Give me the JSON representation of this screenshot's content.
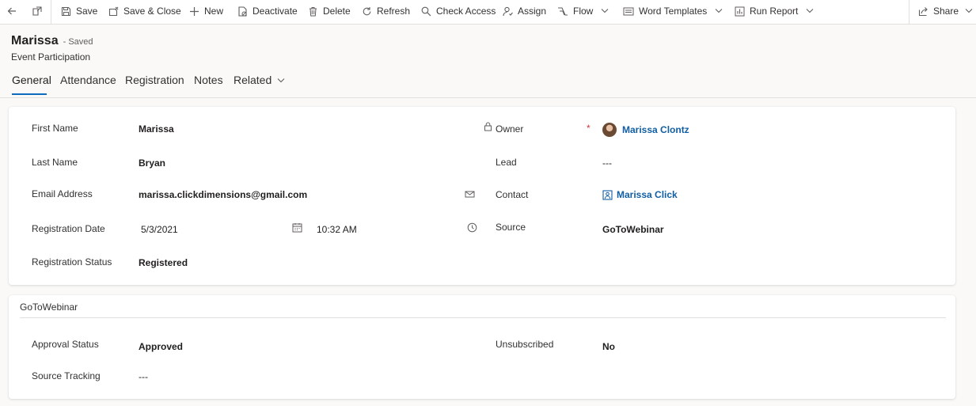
{
  "toolbar": {
    "save": "Save",
    "save_close": "Save & Close",
    "new": "New",
    "deactivate": "Deactivate",
    "delete": "Delete",
    "refresh": "Refresh",
    "check_access": "Check Access",
    "assign": "Assign",
    "flow": "Flow",
    "word_templates": "Word Templates",
    "run_report": "Run Report",
    "share": "Share"
  },
  "header": {
    "title": "Marissa",
    "saved_status": "- Saved",
    "entity": "Event Participation"
  },
  "tabs": [
    "General",
    "Attendance",
    "Registration",
    "Notes",
    "Related"
  ],
  "general": {
    "first_name_label": "First Name",
    "first_name": "Marissa",
    "last_name_label": "Last Name",
    "last_name": "Bryan",
    "email_label": "Email Address",
    "email": "marissa.clickdimensions@gmail.com",
    "reg_date_label": "Registration Date",
    "reg_date": "5/3/2021",
    "reg_time": "10:32 AM",
    "reg_status_label": "Registration Status",
    "reg_status": "Registered",
    "owner_label": "Owner",
    "owner_required": "*",
    "owner": "Marissa Clontz",
    "lead_label": "Lead",
    "lead": "---",
    "contact_label": "Contact",
    "contact": "Marissa Click",
    "source_label": "Source",
    "source": "GoToWebinar"
  },
  "gotowebinar": {
    "section_title": "GoToWebinar",
    "approval_label": "Approval Status",
    "approval": "Approved",
    "source_tracking_label": "Source Tracking",
    "source_tracking": "---",
    "unsubscribed_label": "Unsubscribed",
    "unsubscribed": "No"
  },
  "colors": {
    "link": "#115ea3",
    "accent": "#0f6cbd",
    "required": "#d13438"
  }
}
